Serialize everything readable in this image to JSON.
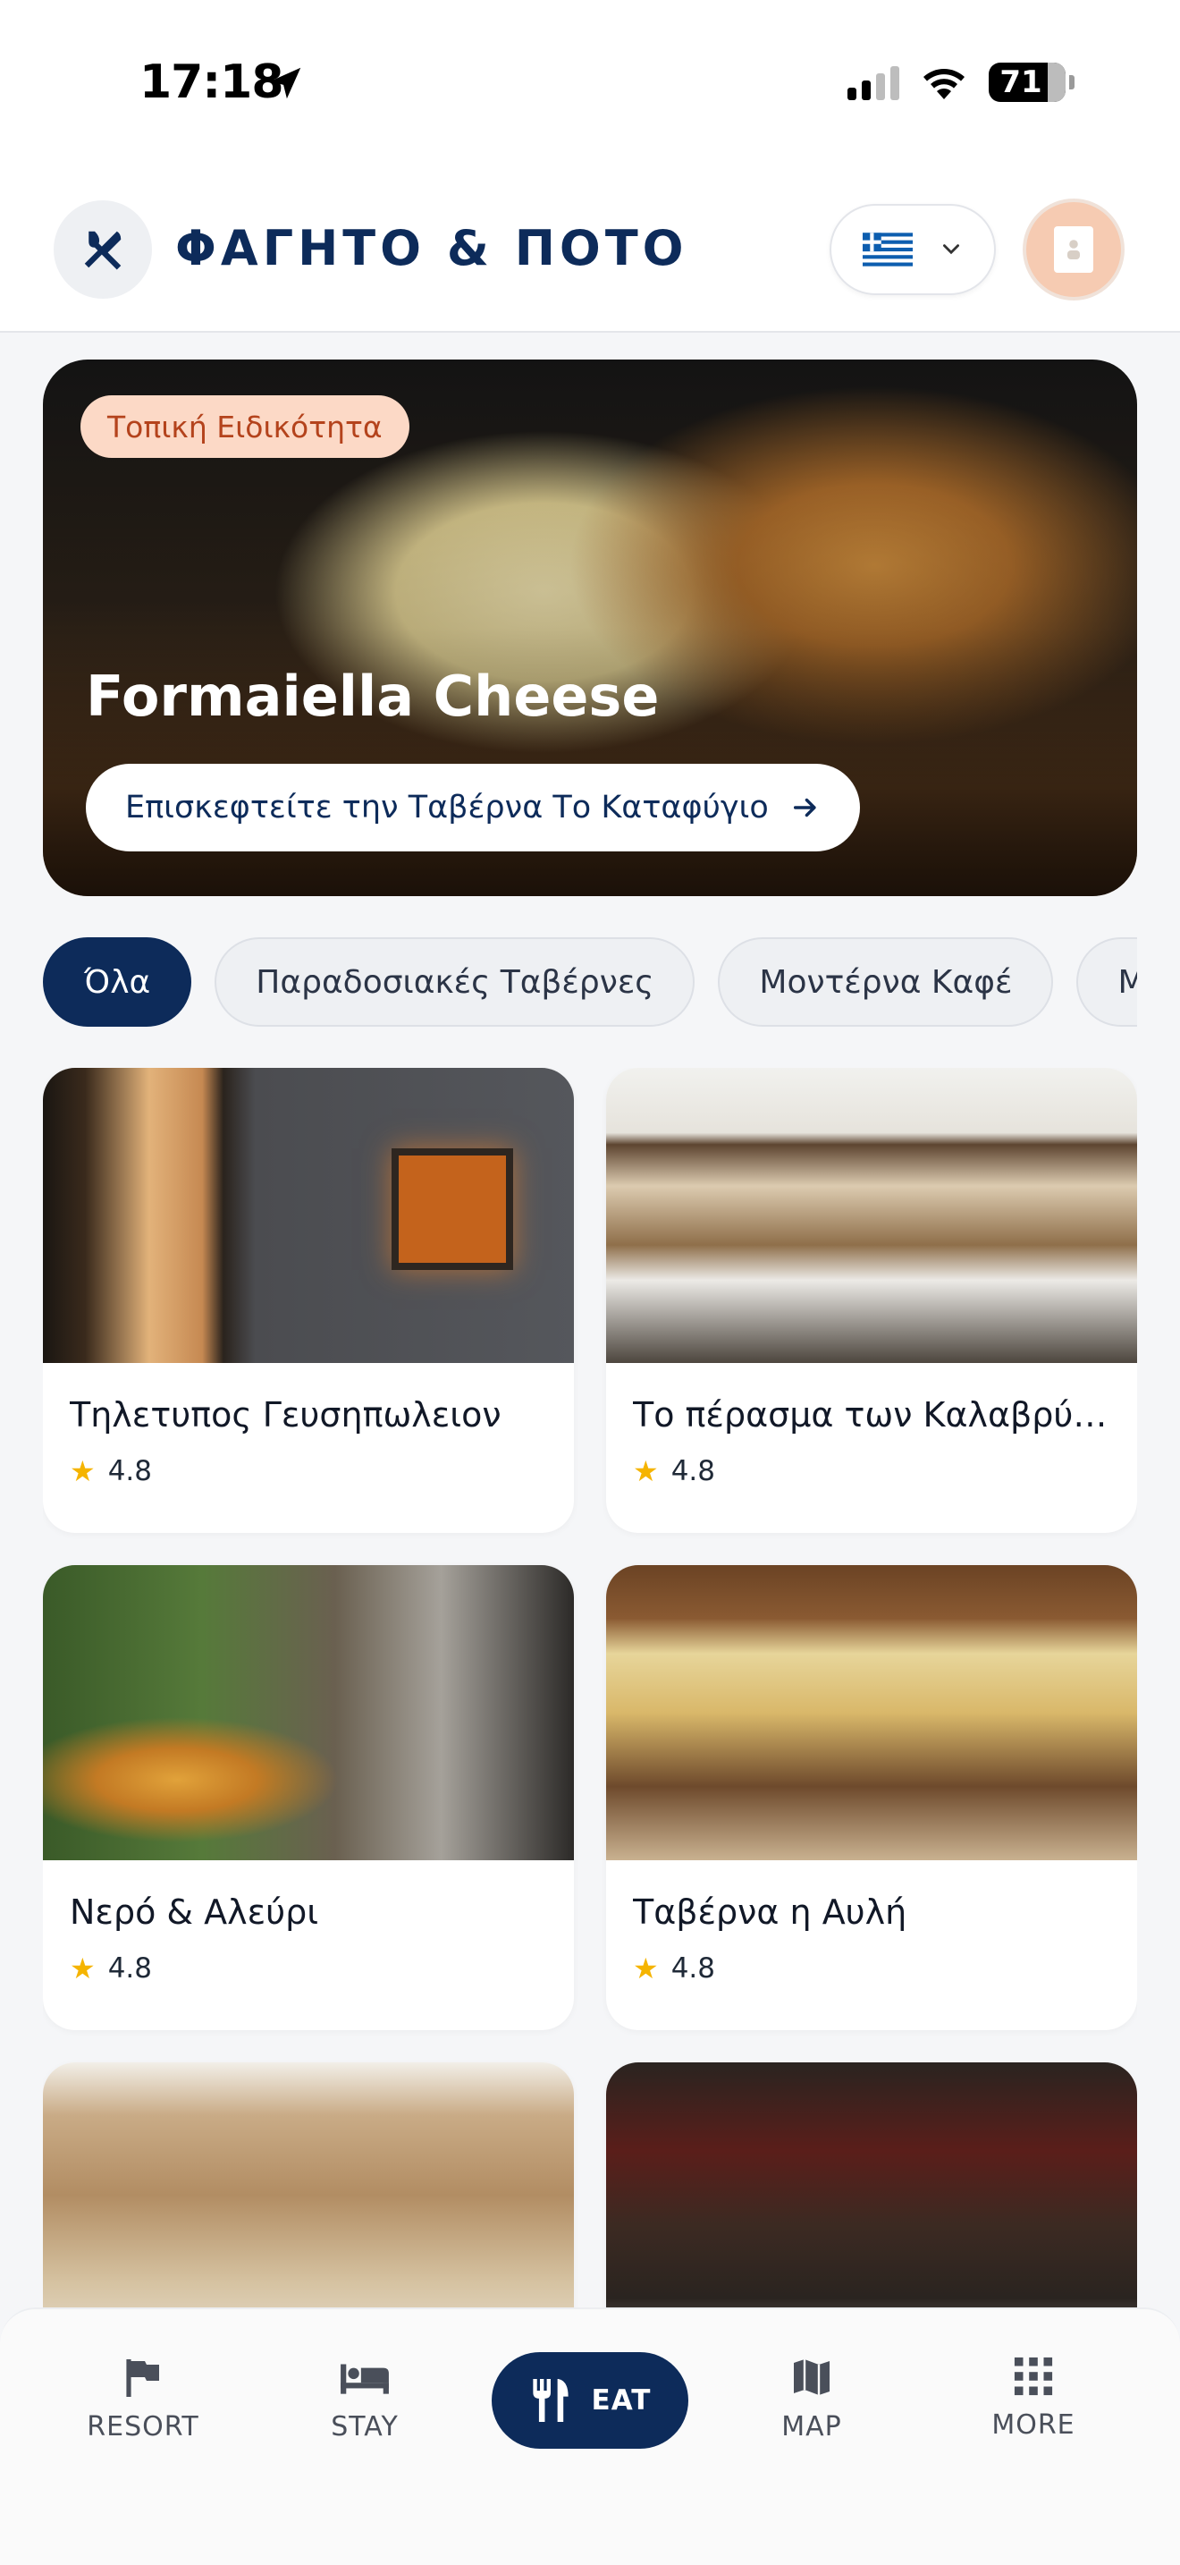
{
  "status_bar": {
    "time": "17:18",
    "battery": "71"
  },
  "header": {
    "title": "ΦΑΓΗΤΟ & ΠΟΤΟ",
    "language": "Greek",
    "accent": "#0d2b5a"
  },
  "featured": {
    "tag": "Τοπική Ειδικότητα",
    "title": "Formaiella Cheese",
    "button_label": "Επισκεφτείτε την Ταβέρνα Το Καταφύγιο"
  },
  "filters": [
    {
      "label": "Όλα",
      "active": true
    },
    {
      "label": "Παραδοσιακές Ταβέρνες",
      "active": false
    },
    {
      "label": "Μοντέρνα Καφέ",
      "active": false
    },
    {
      "label": "Μπαρ",
      "active": false
    }
  ],
  "venues": [
    {
      "name": "Τηλετυπος Γευσηπωλειον",
      "rating": "4.8"
    },
    {
      "name": "Το πέρασμα των Καλαβρύτων",
      "rating": "4.8"
    },
    {
      "name": "Νερό & Αλεύρι",
      "rating": "4.8"
    },
    {
      "name": "Ταβέρνα η Αυλή",
      "rating": "4.8"
    },
    {
      "name": "",
      "rating": ""
    },
    {
      "name": "",
      "rating": ""
    }
  ],
  "nav": {
    "resort": "RESORT",
    "stay": "STAY",
    "eat": "EAT",
    "map": "MAP",
    "more": "MORE"
  }
}
